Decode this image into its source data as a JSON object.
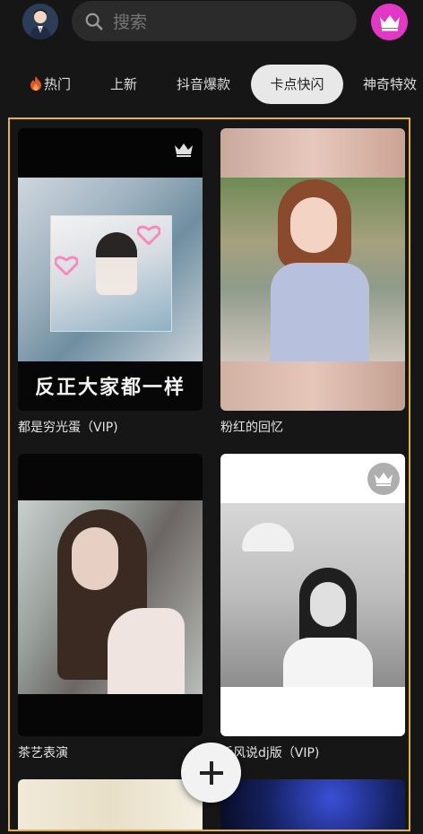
{
  "header": {
    "search_placeholder": "搜索"
  },
  "tabs": [
    {
      "label": "热门",
      "icon": "fire-icon"
    },
    {
      "label": "上新"
    },
    {
      "label": "抖音爆款"
    },
    {
      "label": "卡点快闪",
      "active": true
    },
    {
      "label": "神奇特效"
    }
  ],
  "templates": [
    {
      "title": "都是穷光蛋（VIP)",
      "overlay_text": "反正大家都一样",
      "vip": true
    },
    {
      "title": "粉红的回忆",
      "vip": false
    },
    {
      "title": "茶艺表演",
      "vip": false
    },
    {
      "title": "听风说dj版（VIP)",
      "vip": true
    }
  ],
  "colors": {
    "accent_vip": "#e338c6",
    "frame_highlight": "#e6b52c",
    "background": "#161616"
  }
}
